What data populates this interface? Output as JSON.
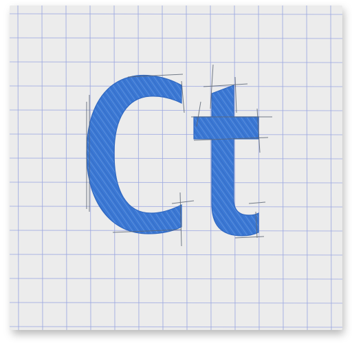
{
  "icon": {
    "name": "app-icon",
    "glyphs": "Ct",
    "colors": {
      "paper": "#ececec",
      "grid_line": "#9aa6e0",
      "grid_line_faint": "#c5cbed",
      "letter_fill": "#3b78d4",
      "letter_fill_dark": "#2f67c0",
      "letter_hatch": "#6d9de3",
      "construction_line": "#5c6675"
    }
  }
}
